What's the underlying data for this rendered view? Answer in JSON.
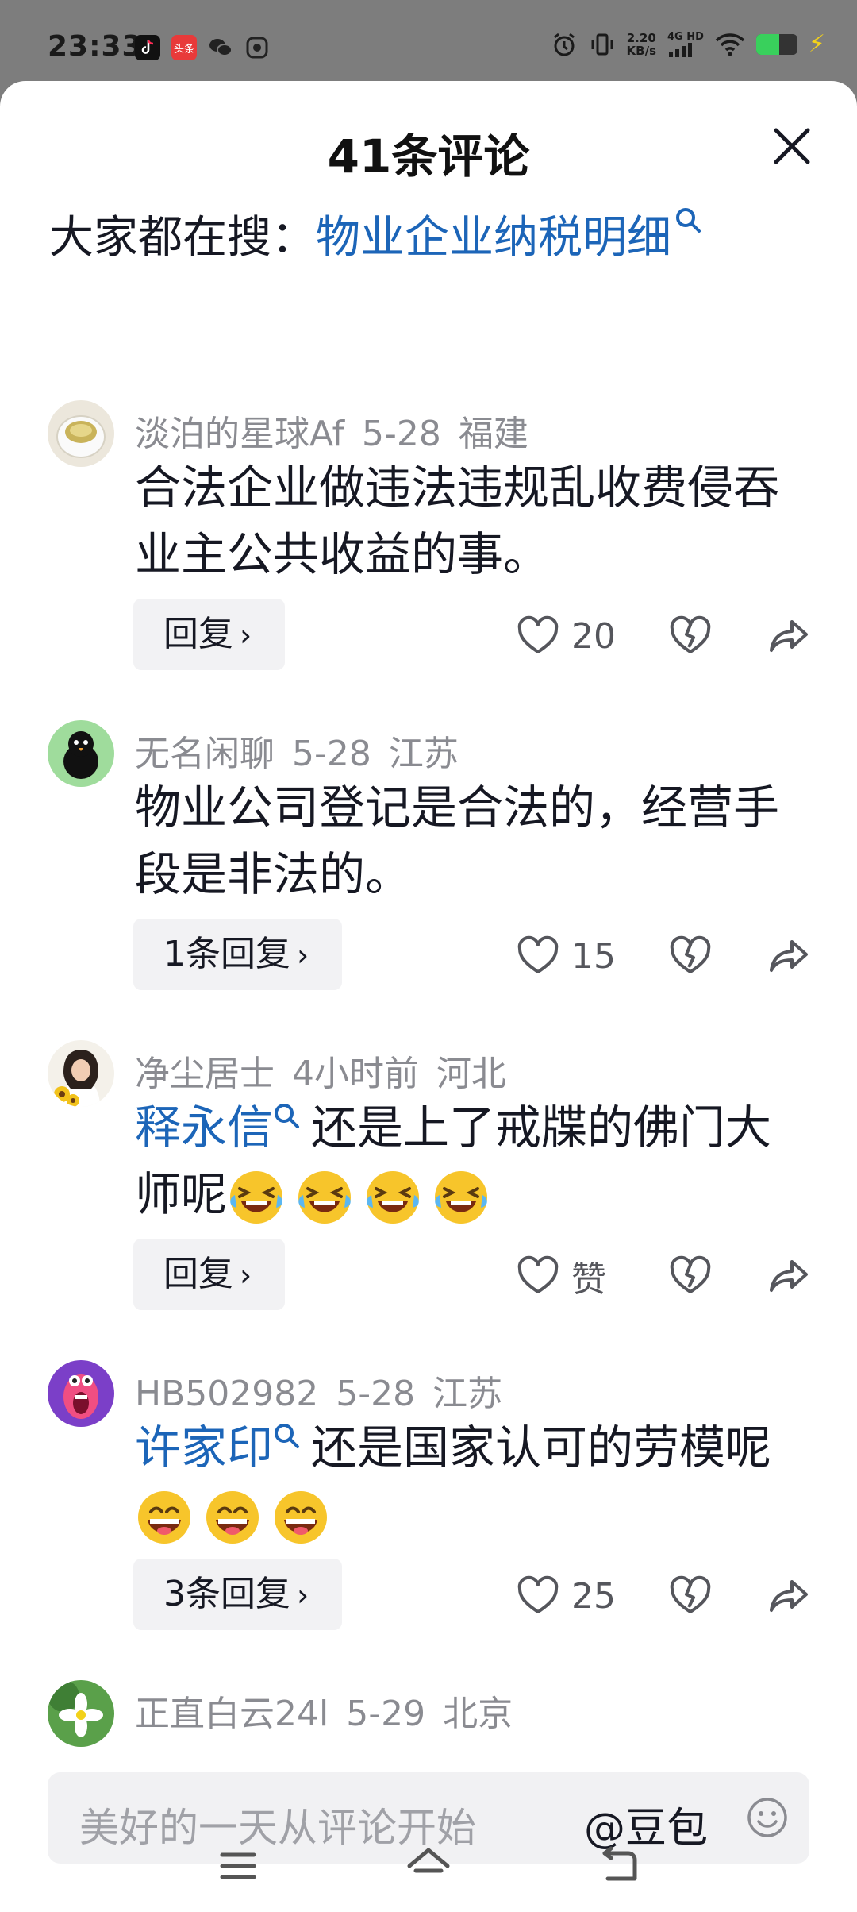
{
  "status_bar": {
    "time": "23:33",
    "app_icons": [
      "douyin-icon",
      "toutiao-icon",
      "wechat-icon",
      "vpn-icon"
    ],
    "toutiao_label": "头条",
    "speed_value": "2.20",
    "speed_unit": "KB/s",
    "network": "4G HD",
    "battery_level": 0.55,
    "charging": true
  },
  "sheet": {
    "title": "41条评论",
    "search_prefix": "大家都在搜：",
    "search_keyword": "物业企业纳税明细"
  },
  "comments": [
    {
      "user": "淡泊的星球Af",
      "date": "5-28",
      "region": "福建",
      "text": "合法企业做违法违规乱收费侵吞业主公共收益的事。",
      "reply_label": "回复",
      "likes": "20"
    },
    {
      "user": "无名闲聊",
      "date": "5-28",
      "region": "江苏",
      "text": "物业公司登记是合法的，经营手段是非法的。",
      "reply_label": "1条回复",
      "likes": "15"
    },
    {
      "user": "净尘居士",
      "date": "4小时前",
      "region": "河北",
      "mention": "释永信",
      "text": "还是上了戒牒的佛门大师呢",
      "emoji": "laugh-cry",
      "emoji_count": 4,
      "reply_label": "回复",
      "likes": "赞"
    },
    {
      "user": "HB502982",
      "date": "5-28",
      "region": "江苏",
      "mention": "许家印",
      "text": "还是国家认可的劳模呢",
      "emoji": "grin",
      "emoji_count": 3,
      "reply_label": "3条回复",
      "likes": "25"
    },
    {
      "user": "正直白云24l",
      "date": "5-29",
      "region": "北京"
    }
  ],
  "input": {
    "placeholder": "美好的一天从评论开始",
    "mention": "@豆包"
  },
  "colors": {
    "link_blue": "#1c65b8",
    "meta_gray": "#8a8b91",
    "text": "#161823",
    "reply_bg": "#f2f2f4"
  }
}
